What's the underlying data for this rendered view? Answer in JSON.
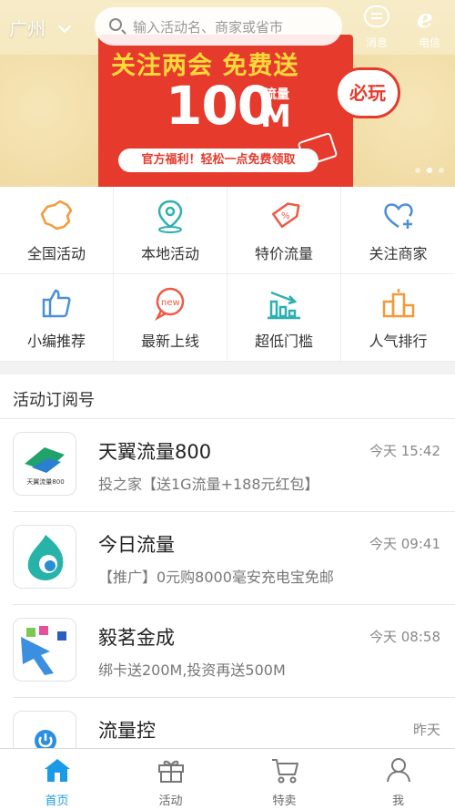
{
  "header": {
    "city": "广州",
    "search_placeholder": "输入活动名、商家或省市",
    "messages_label": "消息",
    "telecom_label": "电信"
  },
  "banner": {
    "title": "关注两会  免费送",
    "big_number": "100",
    "unit_top": "流量",
    "unit_bottom": "M",
    "badge": "必玩",
    "subtitle": "官方福利！轻松一点免费领取",
    "slides": 3,
    "active_slide": 1
  },
  "categories": [
    {
      "label": "全国活动",
      "icon": "china-map-icon"
    },
    {
      "label": "本地活动",
      "icon": "location-pin-icon"
    },
    {
      "label": "特价流量",
      "icon": "price-tag-icon"
    },
    {
      "label": "关注商家",
      "icon": "heart-plus-icon"
    },
    {
      "label": "小编推荐",
      "icon": "thumbs-up-icon"
    },
    {
      "label": "最新上线",
      "icon": "new-bubble-icon"
    },
    {
      "label": "超低门槛",
      "icon": "bar-chart-down-icon"
    },
    {
      "label": "人气排行",
      "icon": "ranking-podium-icon"
    }
  ],
  "subscriptions": {
    "title": "活动订阅号",
    "items": [
      {
        "name": "天翼流量800",
        "time": "今天 15:42",
        "desc": "投之家【送1G流量+188元红包】",
        "logo_text": "天翼流量800"
      },
      {
        "name": "今日流量",
        "time": "今天 09:41",
        "desc": "【推广】0元购8000毫安充电宝免邮",
        "logo_text": ""
      },
      {
        "name": "毅茗金成",
        "time": "今天 08:58",
        "desc": "绑卡送200M,投资再送500M",
        "logo_text": ""
      },
      {
        "name": "流量控",
        "time": "昨天",
        "desc": "",
        "logo_text": ""
      }
    ]
  },
  "tabbar": {
    "tabs": [
      {
        "label": "首页",
        "icon": "home-icon",
        "active": true
      },
      {
        "label": "活动",
        "icon": "gift-icon",
        "active": false
      },
      {
        "label": "特卖",
        "icon": "cart-icon",
        "active": false
      },
      {
        "label": "我",
        "icon": "user-icon",
        "active": false
      }
    ]
  },
  "colors": {
    "accent": "#1a9be8",
    "banner_red": "#e53a2c",
    "icon_orange": "#f29a38",
    "icon_blue": "#4a8fd8",
    "icon_teal": "#2fb0b0",
    "icon_red": "#ef5a44"
  }
}
